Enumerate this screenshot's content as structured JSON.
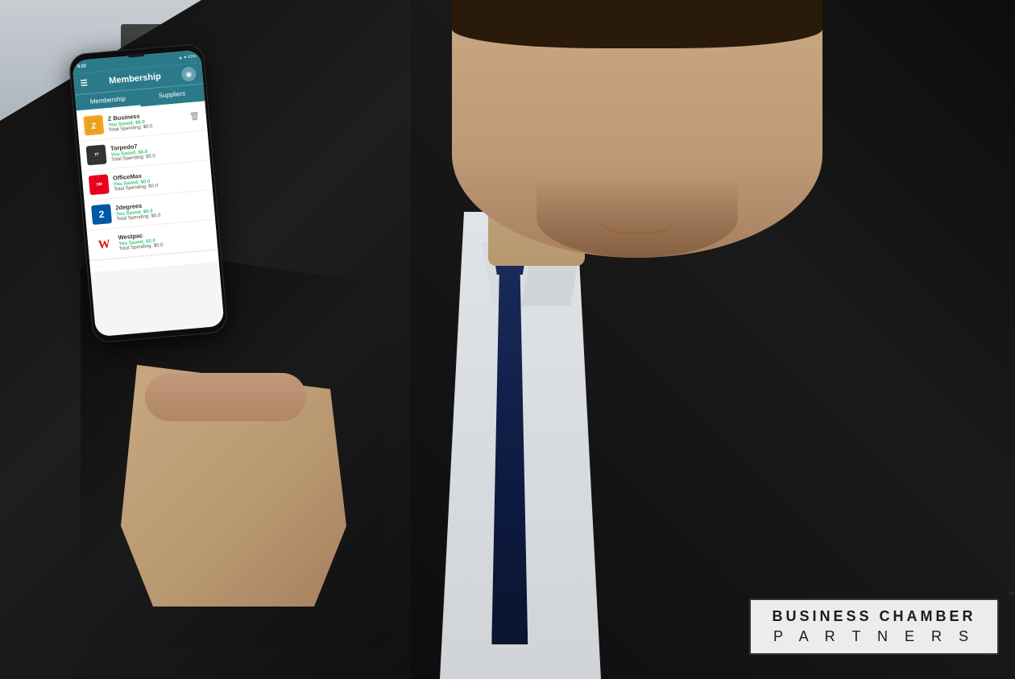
{
  "scene": {
    "background_color": "#8a9aa8"
  },
  "phone": {
    "status_bar": {
      "time": "9:22",
      "battery": "63%",
      "signal": "▲▼"
    },
    "header": {
      "menu_icon": "☰",
      "title": "Membership",
      "avatar_icon": "👤"
    },
    "tabs": [
      {
        "label": "Membership",
        "active": true
      },
      {
        "label": "Suppliers",
        "active": false
      }
    ],
    "suppliers": [
      {
        "name": "Z Business",
        "logo_text": "Z",
        "logo_style": "z",
        "saved_label": "You Saved:",
        "saved_value": "$0.0",
        "total_label": "Total Spending:",
        "total_value": "$0.0",
        "has_delete": true
      },
      {
        "name": "Torpedo7",
        "logo_text": "Torpedo7",
        "logo_style": "torpedo",
        "saved_label": "You Saved:",
        "saved_value": "$0.0",
        "total_label": "Total Spending:",
        "total_value": "$0.0",
        "has_delete": false
      },
      {
        "name": "OfficeMax",
        "logo_text": "OfficeMax",
        "logo_style": "officemax",
        "saved_label": "You Saved:",
        "saved_value": "$0.0",
        "total_label": "Total Spending:",
        "total_value": "$0.0",
        "has_delete": false
      },
      {
        "name": "2degrees",
        "logo_text": "2",
        "logo_style": "2degrees",
        "saved_label": "You Saved:",
        "saved_value": "$0.0",
        "total_label": "Total Spending:",
        "total_value": "$0.0",
        "has_delete": false
      },
      {
        "name": "Westpac",
        "logo_text": "W",
        "logo_style": "westpac",
        "saved_label": "You Saved:",
        "saved_value": "$0.0",
        "total_label": "Total Spending:",
        "total_value": "$0.0",
        "has_delete": false
      }
    ]
  },
  "bcp_logo": {
    "line1": "BUSINESS CHAMBER",
    "line2": "P A R T N E R S",
    "trademark": "™"
  }
}
